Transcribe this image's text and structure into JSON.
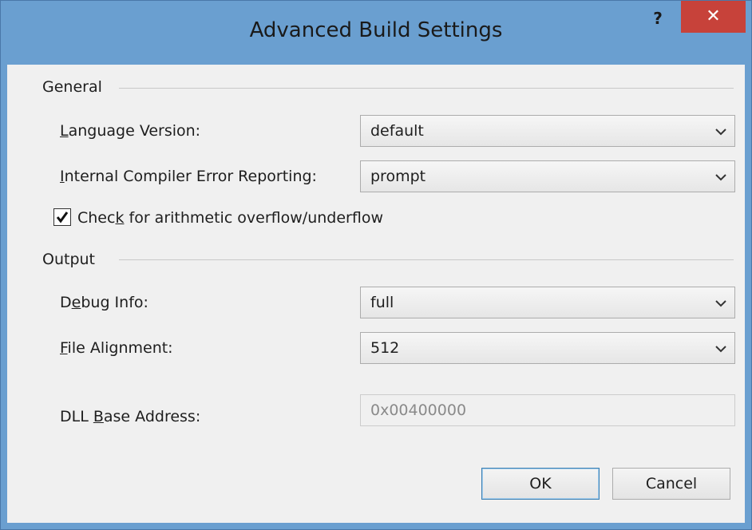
{
  "window": {
    "title": "Advanced Build Settings",
    "help_label": "?",
    "close_label": "✕"
  },
  "general": {
    "header": "General",
    "language_version": {
      "label_pre": "",
      "label_key": "L",
      "label_post": "anguage Version:",
      "value": "default"
    },
    "ice_reporting": {
      "label_pre": "",
      "label_key": "I",
      "label_post": "nternal Compiler Error Reporting:",
      "value": "prompt"
    },
    "overflow_check": {
      "label_pre": "Chec",
      "label_key": "k",
      "label_post": " for arithmetic overflow/underflow",
      "checked": true
    }
  },
  "output": {
    "header": "Output",
    "debug_info": {
      "label_pre": "D",
      "label_key": "e",
      "label_post": "bug Info:",
      "value": "full"
    },
    "file_alignment": {
      "label_pre": "",
      "label_key": "F",
      "label_post": "ile Alignment:",
      "value": "512"
    },
    "dll_base_address": {
      "label_pre": "DLL ",
      "label_key": "B",
      "label_post": "ase Address:",
      "value": "0x00400000"
    }
  },
  "buttons": {
    "ok": "OK",
    "cancel": "Cancel"
  },
  "colors": {
    "frame": "#6a9fd0",
    "close_button": "#c7423a",
    "client": "#f0f0f0"
  },
  "icons": {
    "close": "close-icon",
    "help": "help-icon",
    "dropdown": "chevron-down-icon",
    "check": "checkmark-icon"
  }
}
